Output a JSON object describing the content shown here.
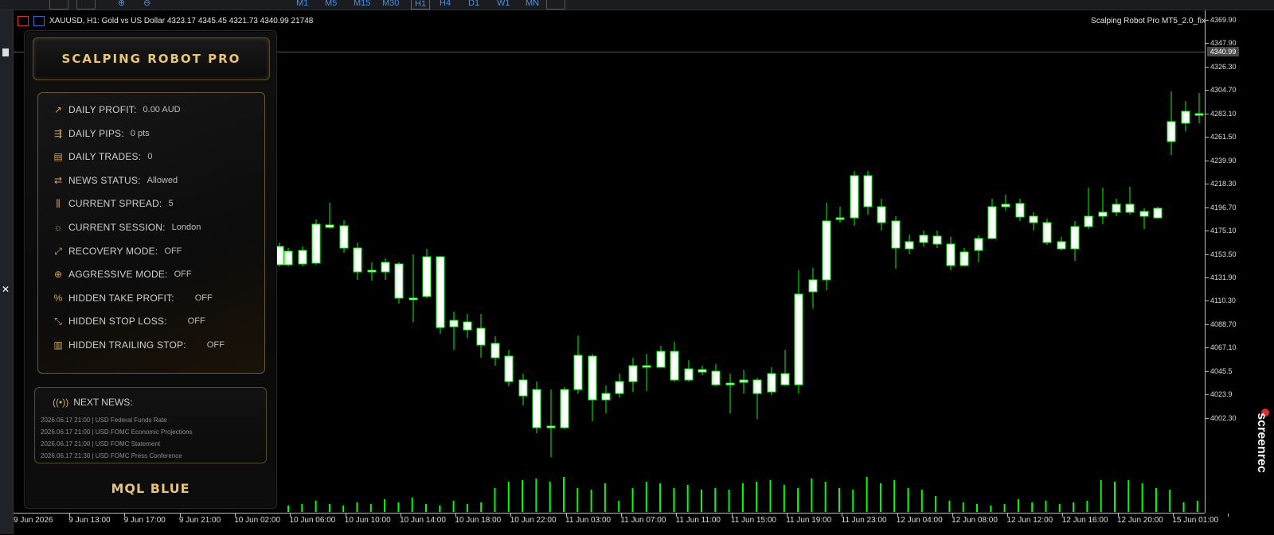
{
  "toolbar": {
    "timeframes": [
      "M1",
      "M5",
      "M15",
      "M30",
      "H1",
      "H4",
      "D1",
      "W1",
      "MN"
    ],
    "active_timeframe": "H1"
  },
  "chart": {
    "symbol_line": "XAUUSD, H1:  Gold vs US Dollar  4323.17 4345.45 4321.73 4340.99  21748",
    "robot_name": "Scalping Robot Pro MT5_2.0_fix",
    "current_price": "4340.99",
    "price_labels": [
      "4369.90",
      "4347.90",
      "4326.30",
      "4304.70",
      "4283.10",
      "4261.50",
      "4239.90",
      "4218.30",
      "4196.70",
      "4175.10",
      "4153.50",
      "4131.90",
      "4110.30",
      "4088.70",
      "4067.10",
      "4045.5",
      "4023.9",
      "4002.30"
    ],
    "time_labels": [
      "9 Jun 2026",
      "9 Jun 13:00",
      "9 Jun 17:00",
      "9 Jun 21:00",
      "10 Jun 02:00",
      "10 Jun 06:00",
      "10 Jun 10:00",
      "10 Jun 14:00",
      "10 Jun 18:00",
      "10 Jun 22:00",
      "11 Jun 03:00",
      "11 Jun 07:00",
      "11 Jun 11:00",
      "11 Jun 15:00",
      "11 Jun 19:00",
      "11 Jun 23:00",
      "12 Jun 04:00",
      "12 Jun 08:00",
      "12 Jun 12:00",
      "12 Jun 16:00",
      "12 Jun 20:00",
      "15 Jun 01:00"
    ],
    "colors": {
      "bull_fill": "#000000",
      "bear_fill": "#ffffff",
      "wick": "#00ff00",
      "volume": "#00ff00"
    }
  },
  "panel": {
    "title": "SCALPING ROBOT PRO",
    "stats": [
      {
        "icon": "trend-up-icon",
        "glyph": "↗",
        "label": "DAILY PROFIT:",
        "value": "0.00 AUD"
      },
      {
        "icon": "pips-icon",
        "glyph": "⇶",
        "label": "DAILY PIPS:",
        "value": "0 pts"
      },
      {
        "icon": "trades-icon",
        "glyph": "▤",
        "label": "DAILY TRADES:",
        "value": "0"
      },
      {
        "icon": "news-status-icon",
        "glyph": "⇄",
        "label": "NEWS STATUS:",
        "value": "Allowed"
      },
      {
        "icon": "spread-icon",
        "glyph": "⫼",
        "label": "CURRENT SPREAD:",
        "value": "5"
      },
      {
        "icon": "session-icon",
        "glyph": "☼",
        "label": "CURRENT SESSION:",
        "value": "London"
      },
      {
        "icon": "recovery-icon",
        "glyph": "⤢",
        "label": "RECOVERY MODE:",
        "value": "OFF"
      },
      {
        "icon": "aggressive-icon",
        "glyph": "⊕",
        "label": "AGGRESSIVE MODE:",
        "value": "OFF"
      },
      {
        "icon": "take-profit-icon",
        "glyph": "%",
        "label": "HIDDEN TAKE PROFIT:",
        "value": "OFF"
      },
      {
        "icon": "stop-loss-icon",
        "glyph": "⤡",
        "label": "HIDDEN STOP LOSS:",
        "value": "OFF"
      },
      {
        "icon": "trailing-stop-icon",
        "glyph": "▥",
        "label": "HIDDEN TRAILING STOP:",
        "value": "OFF"
      }
    ],
    "news_title": "NEXT NEWS:",
    "news": [
      "2026.06.17 21:00 | USD Federal Funds Rate",
      "2026.06.17 21:00 | USD FOMC Economic Projections",
      "2026.06.17 21:00 | USD FOMC Statement",
      "2026.06.17 21:30 | USD FOMC Press Conference"
    ],
    "footer": "MQL BLUE"
  },
  "watermark": "screenrec"
}
